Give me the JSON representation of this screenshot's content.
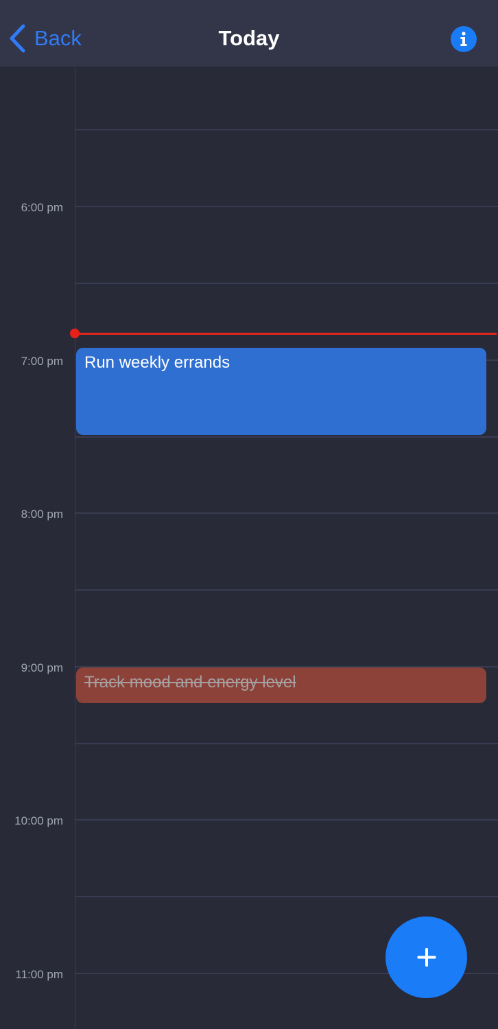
{
  "header": {
    "back_label": "Back",
    "title": "Today",
    "info_icon": "info-icon"
  },
  "calendar": {
    "time_labels": [
      "6:00 pm",
      "7:00 pm",
      "8:00 pm",
      "9:00 pm",
      "10:00 pm",
      "11:00 pm"
    ],
    "events": [
      {
        "title": "Run weekly errands",
        "color": "#2f6fd2",
        "completed": false
      },
      {
        "title": "Track mood and energy level",
        "color": "#8c4139",
        "completed": true
      }
    ],
    "now_indicator_color": "#e0261e"
  },
  "fab": {
    "icon": "plus-icon",
    "color": "#1a7cf6"
  },
  "colors": {
    "background": "#282a38",
    "header": "#333548",
    "accent": "#2f7cf6"
  }
}
